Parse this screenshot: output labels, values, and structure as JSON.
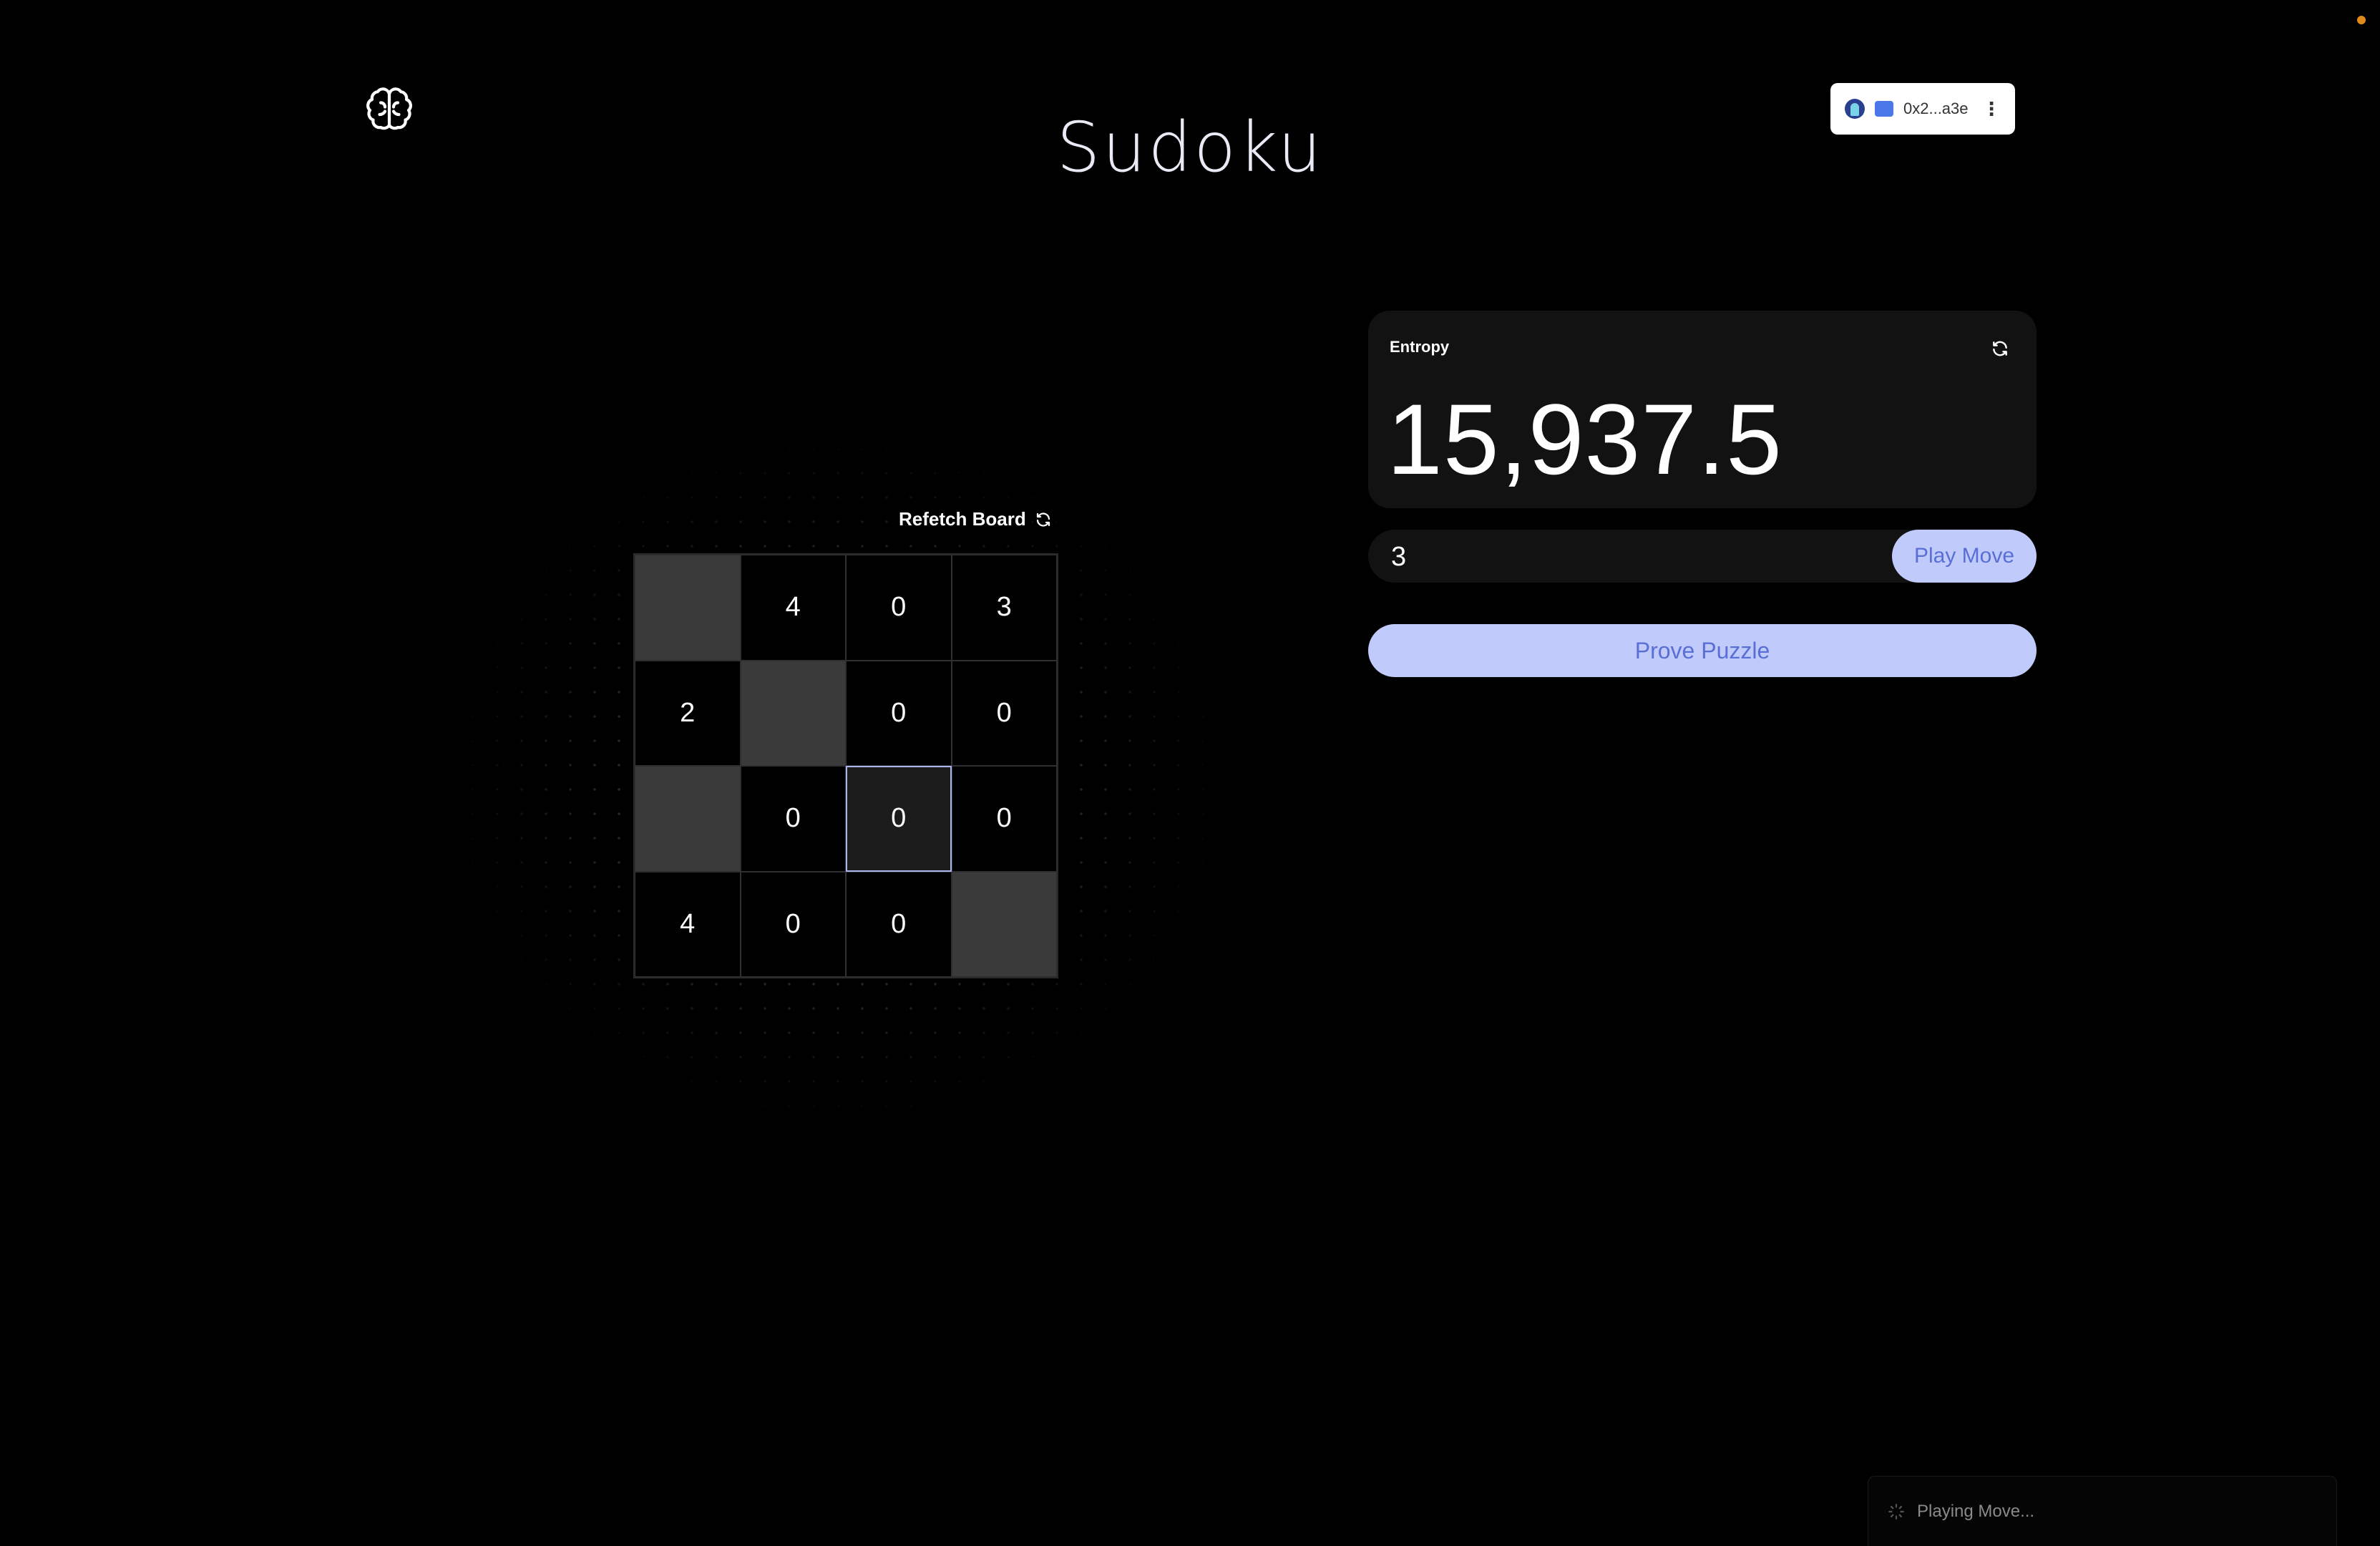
{
  "header": {
    "title": "Sudoku",
    "logo_icon": "brain-icon",
    "wallet": {
      "address": "0x2...a3e",
      "menu_icon": "more-vertical-icon"
    }
  },
  "board": {
    "refetch_label": "Refetch Board",
    "cells": [
      [
        "",
        "4",
        "0",
        "3"
      ],
      [
        "2",
        "",
        "0",
        "0"
      ],
      [
        "",
        "0",
        "0",
        "0"
      ],
      [
        "4",
        "0",
        "0",
        ""
      ]
    ],
    "selected_cell": [
      2,
      2
    ]
  },
  "entropy": {
    "label": "Entropy",
    "value": "15,937.5"
  },
  "move": {
    "input_value": "3",
    "play_label": "Play Move"
  },
  "prove": {
    "label": "Prove Puzzle"
  },
  "toast": {
    "message": "Playing Move..."
  },
  "colors": {
    "accent": "#c1cbfb",
    "accent_text": "#5a6fd6",
    "background": "#000000",
    "card": "#121212",
    "empty_cell": "#3a3a3a",
    "selected_border": "#a8b8ee"
  }
}
